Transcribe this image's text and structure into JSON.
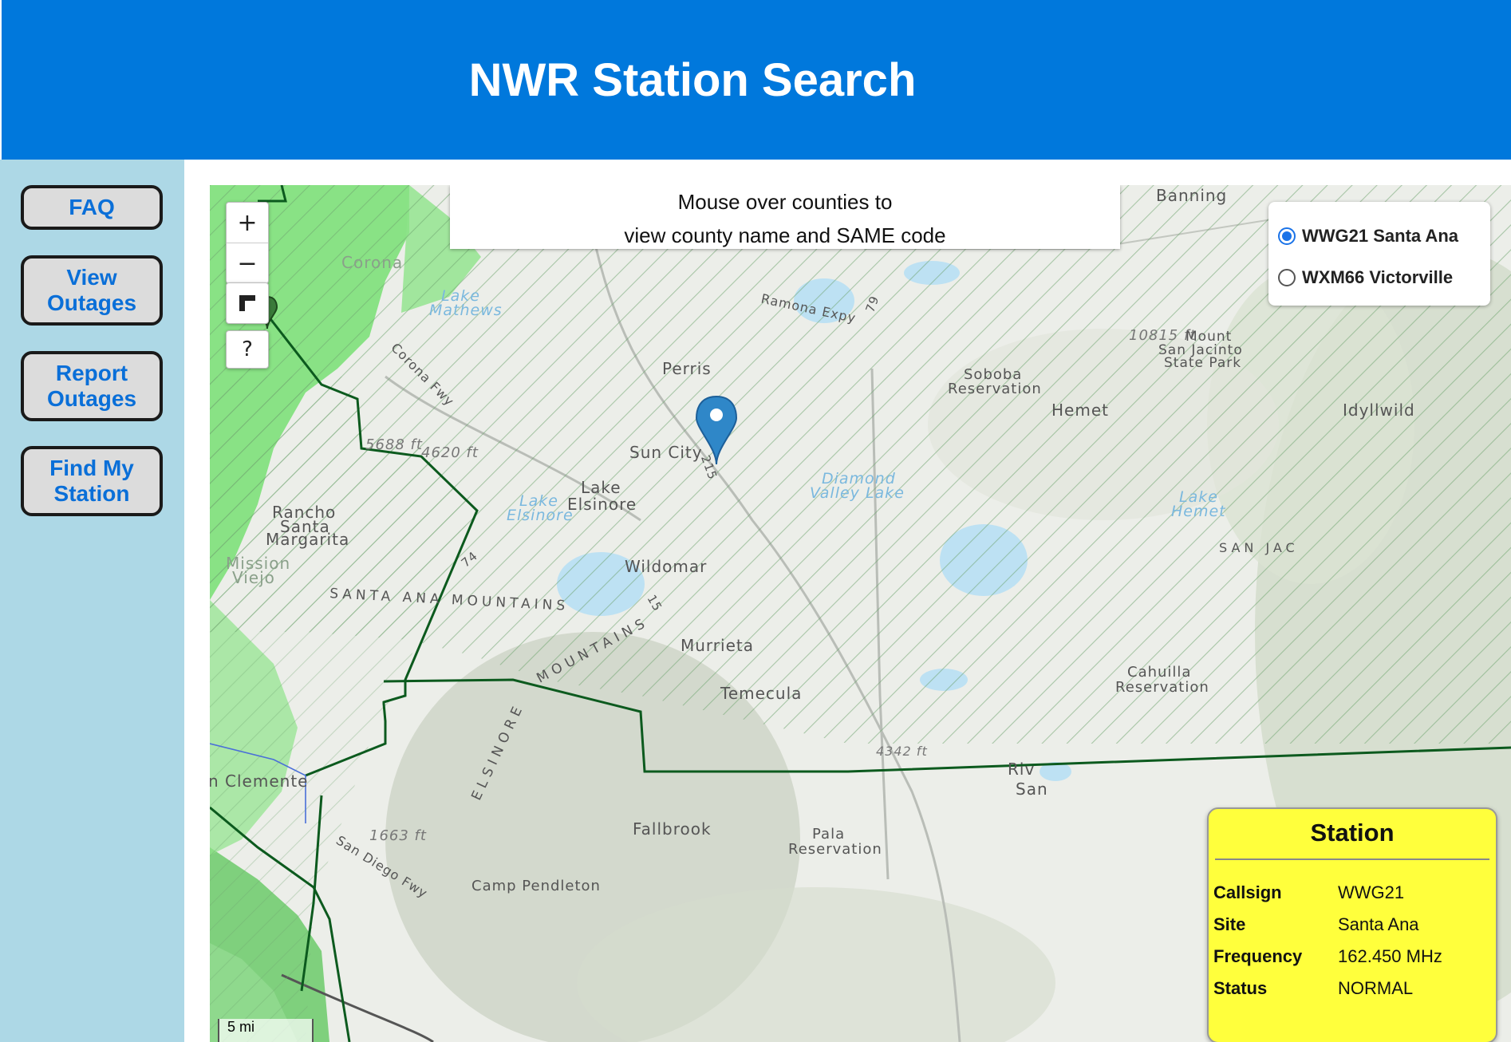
{
  "header": {
    "title": "NWR Station Search"
  },
  "sidebar": {
    "buttons": [
      {
        "label": "FAQ"
      },
      {
        "label": "View Outages"
      },
      {
        "label": "Report Outages"
      },
      {
        "label": "Find My Station"
      }
    ]
  },
  "map": {
    "zoom_in": "+",
    "zoom_out": "−",
    "help": "?",
    "info": {
      "line1": "Mouse over counties to",
      "line2": "view county name and SAME code"
    },
    "stations": [
      {
        "label": "WWG21 Santa Ana",
        "selected": true
      },
      {
        "label": "WXM66 Victorville",
        "selected": false
      }
    ],
    "scale": "5 mi",
    "places": {
      "banning": "Banning",
      "corona": "Corona",
      "perris": "Perris",
      "sun_city": "Sun City",
      "lake_elsinore": "Lake",
      "lake_elsinore2": "Elsinore",
      "hemet": "Hemet",
      "idyllwild": "Idyllwild",
      "wildomar": "Wildomar",
      "murrieta": "Murrieta",
      "temecula": "Temecula",
      "fallbrook": "Fallbrook",
      "rancho": "Rancho",
      "santa": "Santa",
      "margarita": "Margarita",
      "mission": "Mission",
      "viejo": "Viejo",
      "soboba": "Soboba",
      "reservation": "Reservation",
      "cahuilla": "Cahuilla",
      "cahuilla_res": "Reservation",
      "pala": "Pala",
      "pala_res": "Reservation",
      "camp_pendleton": "Camp Pendleton",
      "clemente": "n Clemente",
      "mount": "Mount",
      "san_jacinto": "San Jacinto",
      "state_park": "State Park",
      "peak": "10815 ft",
      "santa_ana_mtns": "SANTA ANA MOUNTAINS",
      "elsinore_mtns": "MOUNTAINS",
      "elsinore_vert": "ELSINORE",
      "ramona": "Ramona Expy",
      "corona_fwy": "Corona Fwy",
      "san_diego_fwy": "San Diego Fwy",
      "elev1": "5688 ft",
      "elev2": "4620 ft",
      "elev3": "4342 ft",
      "elev4": "1663 ft",
      "riv": "Riv",
      "san": "San",
      "san_jac_mtn": "SAN JAC",
      "lake_mathews": "Lake",
      "lake_mathews2": "Mathews",
      "diamond": "Diamond",
      "valley_lake": "Valley Lake",
      "lake_hemet": "Lake",
      "lake_hemet2": "Hemet",
      "lake_els_water": "Lake",
      "lake_els_water2": "Elsinore",
      "hwy15": "15",
      "hwy215": "215",
      "hwy74": "74",
      "hwy79": "79"
    }
  },
  "station_info": {
    "title": "Station",
    "rows": [
      {
        "key": "Callsign",
        "value": "WWG21"
      },
      {
        "key": "Site",
        "value": "Santa Ana"
      },
      {
        "key": "Frequency",
        "value": "162.450 MHz"
      },
      {
        "key": "Status",
        "value": "NORMAL"
      }
    ]
  },
  "colors": {
    "header": "#0078dc",
    "sidebar": "#add8e6",
    "button_text": "#0a6fd8",
    "coverage_green": "#7ee07a",
    "boundary": "#0c5a1e",
    "station_card": "#ffff3c"
  }
}
